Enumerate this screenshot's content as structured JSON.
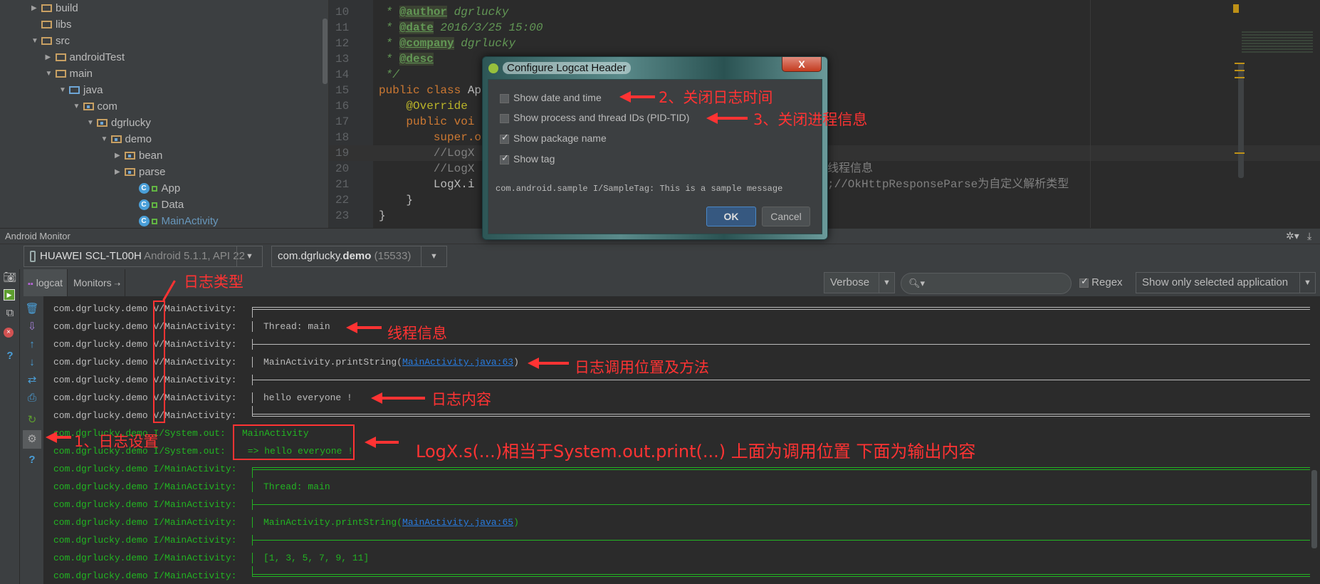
{
  "project_tree": [
    {
      "label": "build",
      "depth": 1,
      "arrow": "▶",
      "icon": "folder"
    },
    {
      "label": "libs",
      "depth": 1,
      "arrow": "",
      "icon": "folder"
    },
    {
      "label": "src",
      "depth": 1,
      "arrow": "▼",
      "icon": "folder"
    },
    {
      "label": "androidTest",
      "depth": 2,
      "arrow": "▶",
      "icon": "folder"
    },
    {
      "label": "main",
      "depth": 2,
      "arrow": "▼",
      "icon": "folder"
    },
    {
      "label": "java",
      "depth": 3,
      "arrow": "▼",
      "icon": "folder-blue"
    },
    {
      "label": "com",
      "depth": 4,
      "arrow": "▼",
      "icon": "package"
    },
    {
      "label": "dgrlucky",
      "depth": 5,
      "arrow": "▼",
      "icon": "package"
    },
    {
      "label": "demo",
      "depth": 6,
      "arrow": "▼",
      "icon": "package"
    },
    {
      "label": "bean",
      "depth": 7,
      "arrow": "▶",
      "icon": "package"
    },
    {
      "label": "parse",
      "depth": 7,
      "arrow": "▶",
      "icon": "package"
    },
    {
      "label": "App",
      "depth": 8,
      "arrow": "",
      "icon": "class"
    },
    {
      "label": "Data",
      "depth": 8,
      "arrow": "",
      "icon": "class"
    },
    {
      "label": "MainActivity",
      "depth": 8,
      "arrow": "",
      "icon": "class",
      "selected": true
    }
  ],
  "editor": {
    "lines": [
      {
        "num": "10",
        "html": [
          [
            " * ",
            "jd"
          ],
          [
            "@author",
            "tag"
          ],
          [
            " dgrlucky",
            "jd"
          ]
        ]
      },
      {
        "num": "11",
        "html": [
          [
            " * ",
            "jd"
          ],
          [
            "@date",
            "tag"
          ],
          [
            " 2016/3/25 15:00",
            "jd"
          ]
        ]
      },
      {
        "num": "12",
        "html": [
          [
            " * ",
            "jd"
          ],
          [
            "@company",
            "tag"
          ],
          [
            " dgrlucky",
            "jd"
          ]
        ]
      },
      {
        "num": "13",
        "html": [
          [
            " * ",
            "jd"
          ],
          [
            "@desc",
            "tag"
          ]
        ]
      },
      {
        "num": "14",
        "html": [
          [
            " */",
            "jd"
          ]
        ]
      },
      {
        "num": "15",
        "html": [
          [
            "public class ",
            "kw"
          ],
          [
            "Ap",
            ""
          ]
        ]
      },
      {
        "num": "16",
        "html": [
          [
            "    ",
            ""
          ],
          [
            "@Override",
            "ann"
          ]
        ]
      },
      {
        "num": "17",
        "html": [
          [
            "    ",
            ""
          ],
          [
            "public voi",
            "kw"
          ]
        ]
      },
      {
        "num": "18",
        "html": [
          [
            "        ",
            ""
          ],
          [
            "super.o",
            "kw"
          ]
        ]
      },
      {
        "num": "19",
        "html": [
          [
            "        ",
            ""
          ],
          [
            "//LogX",
            "cm"
          ]
        ],
        "current": true
      },
      {
        "num": "20",
        "html": [
          [
            "        ",
            ""
          ],
          [
            "//LogX",
            "cm"
          ]
        ],
        "tail": "线程信息"
      },
      {
        "num": "21",
        "html": [
          [
            "        ",
            ""
          ],
          [
            "LogX.i",
            ""
          ]
        ],
        "tail": ";//OkHttpResponseParse为自定义解析类型"
      },
      {
        "num": "22",
        "html": [
          [
            "    }",
            ""
          ]
        ]
      },
      {
        "num": "23",
        "html": [
          [
            "}",
            ""
          ]
        ]
      }
    ]
  },
  "monitor": {
    "title": "Android Monitor",
    "device_name": "HUAWEI SCL-TL00H",
    "device_info": "Android 5.1.1, API 22",
    "process_prefix": "com.dgrlucky.",
    "process_bold": "demo",
    "process_pid": "(15533)",
    "tabs": [
      "logcat",
      "Monitors"
    ],
    "log_level": "Verbose",
    "search_value": "",
    "regex_label": "Regex",
    "regex_checked": true,
    "filter": "Show only selected application"
  },
  "log_rows": [
    {
      "prefix": "com.dgrlucky.demo V/MainActivity: ",
      "kind": "top",
      "level": "V"
    },
    {
      "prefix": "com.dgrlucky.demo V/MainActivity: ",
      "kind": "text",
      "msg": "Thread: main",
      "level": "V"
    },
    {
      "prefix": "com.dgrlucky.demo V/MainActivity: ",
      "kind": "mid",
      "level": "V"
    },
    {
      "prefix": "com.dgrlucky.demo V/MainActivity: ",
      "kind": "link",
      "msg": "MainActivity.printString(",
      "link": "MainActivity.java:63",
      "after": ")",
      "level": "V"
    },
    {
      "prefix": "com.dgrlucky.demo V/MainActivity: ",
      "kind": "mid",
      "level": "V"
    },
    {
      "prefix": "com.dgrlucky.demo V/MainActivity: ",
      "kind": "text",
      "msg": "hello everyone !",
      "level": "V"
    },
    {
      "prefix": "com.dgrlucky.demo V/MainActivity: ",
      "kind": "bot",
      "level": "V"
    },
    {
      "prefix": "com.dgrlucky.demo I/System.out: ",
      "kind": "plain",
      "msg": "MainActivity",
      "level": "I"
    },
    {
      "prefix": "com.dgrlucky.demo I/System.out: ",
      "kind": "plain",
      "msg": " => hello everyone !",
      "level": "I"
    },
    {
      "prefix": "com.dgrlucky.demo I/MainActivity: ",
      "kind": "top",
      "level": "I"
    },
    {
      "prefix": "com.dgrlucky.demo I/MainActivity: ",
      "kind": "text",
      "msg": "Thread: main",
      "level": "I"
    },
    {
      "prefix": "com.dgrlucky.demo I/MainActivity: ",
      "kind": "mid",
      "level": "I"
    },
    {
      "prefix": "com.dgrlucky.demo I/MainActivity: ",
      "kind": "link",
      "msg": "MainActivity.printString(",
      "link": "MainActivity.java:65",
      "after": ")",
      "level": "I"
    },
    {
      "prefix": "com.dgrlucky.demo I/MainActivity: ",
      "kind": "mid",
      "level": "I"
    },
    {
      "prefix": "com.dgrlucky.demo I/MainActivity: ",
      "kind": "text",
      "msg": "[1, 3, 5, 7, 9, 11]",
      "level": "I"
    },
    {
      "prefix": "com.dgrlucky.demo I/MainActivity: ",
      "kind": "bot",
      "level": "I"
    }
  ],
  "dialog": {
    "title": "Configure Logcat Header",
    "close": "X",
    "options": [
      {
        "label": "Show date and time",
        "checked": false
      },
      {
        "label": "Show process and thread IDs (PID-TID)",
        "checked": false
      },
      {
        "label": "Show package name",
        "checked": true
      },
      {
        "label": "Show tag",
        "checked": true
      }
    ],
    "sample": "com.android.sample I/SampleTag: This is a sample message",
    "ok": "OK",
    "cancel": "Cancel"
  },
  "annotations": {
    "log_type": "日志类型",
    "close_time": "2、关闭日志时间",
    "close_process": "3、关闭进程信息",
    "thread_info": "线程信息",
    "call_location": "日志调用位置及方法",
    "log_content": "日志内容",
    "log_settings": "1、日志设置",
    "logx_s": "LogX.s(...)相当于System.out.print(...)  上面为调用位置  下面为输出内容"
  },
  "colors": {
    "verbose": "#bbbbbb",
    "info": "#22b422",
    "link": "#287bde",
    "annotation": "#ff3333",
    "background": "#2b2b2b",
    "panel": "#3c3f41"
  }
}
